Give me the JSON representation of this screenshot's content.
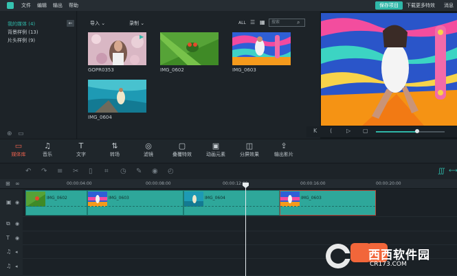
{
  "menu": {
    "items": [
      "文件",
      "编辑",
      "输出",
      "帮助"
    ],
    "save_label": "保存项目",
    "download_more": "下载更多特效",
    "messages": "消息"
  },
  "library": {
    "items": [
      "我的媒体 (4)",
      "背景样例 (13)",
      "片头样例 (9)"
    ],
    "collapse_icon": "arrow-left-icon"
  },
  "media": {
    "import_label": "导入",
    "record_label": "录制",
    "all_label": "ALL",
    "search_placeholder": "搜索",
    "items": [
      {
        "name": "GOPR0353"
      },
      {
        "name": "IMG_0602"
      },
      {
        "name": "IMG_0603"
      },
      {
        "name": "IMG_0604"
      }
    ]
  },
  "player": {
    "progress": 0.6
  },
  "tabs": [
    {
      "label": "媒体库",
      "icon": "folder-icon",
      "active": true
    },
    {
      "label": "音乐",
      "icon": "music-icon"
    },
    {
      "label": "文字",
      "icon": "text-icon"
    },
    {
      "label": "转场",
      "icon": "transition-icon"
    },
    {
      "label": "滤镜",
      "icon": "filter-icon"
    },
    {
      "label": "叠覆特效",
      "icon": "overlay-icon"
    },
    {
      "label": "动画元素",
      "icon": "elements-icon"
    },
    {
      "label": "分屏效果",
      "icon": "split-screen-icon"
    },
    {
      "label": "输出影片",
      "icon": "export-icon"
    }
  ],
  "ruler": {
    "ticks": [
      "00:00:04:00",
      "00:00:08:00",
      "00:00:12:00",
      "00:00:16:00",
      "00:00:20:00"
    ]
  },
  "clips": [
    {
      "label": "IMG_0602"
    },
    {
      "label": "IMG_0603"
    },
    {
      "label": "IMG_0604"
    },
    {
      "label": "IMG_0603"
    }
  ],
  "watermark": {
    "text": "西西软件园",
    "sub": "CR173.COM"
  },
  "colors": {
    "accent": "#2fb7a8",
    "active_tab": "#e9614e",
    "clip": "#2ea79a"
  }
}
